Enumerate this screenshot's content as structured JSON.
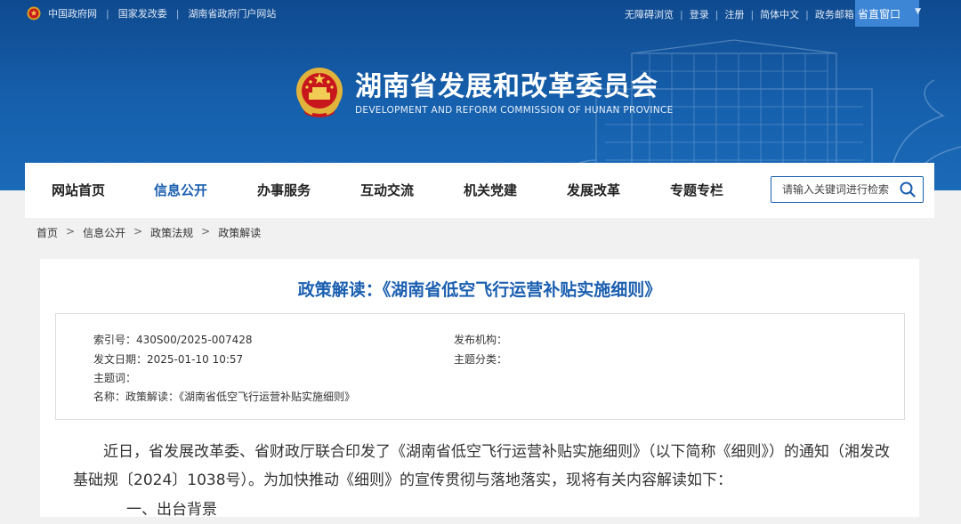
{
  "topbar": {
    "links": [
      "中国政府网",
      "国家发改委",
      "湖南省政府门户网站"
    ],
    "right_links": [
      "无障碍浏览",
      "登录",
      "注册",
      "简体中文",
      "政务邮箱"
    ],
    "province_window": "省直窗口"
  },
  "brand": {
    "name_cn": "湖南省发展和改革委员会",
    "name_en": "DEVELOPMENT AND REFORM COMMISSION OF HUNAN PROVINCE"
  },
  "nav": {
    "items": [
      "网站首页",
      "信息公开",
      "办事服务",
      "互动交流",
      "机关党建",
      "发展改革",
      "专题专栏"
    ],
    "active_index": 1,
    "search_placeholder": "请输入关键词进行检索"
  },
  "breadcrumb": [
    "首页",
    "信息公开",
    "政策法规",
    "政策解读"
  ],
  "article": {
    "title": "政策解读：《湖南省低空飞行运营补贴实施细则》",
    "meta": {
      "index_label": "索引号：",
      "index_value": "430S00/2025-007428",
      "publisher_label": "发布机构：",
      "publisher_value": "",
      "date_label": "发文日期：",
      "date_value": "2025-01-10 10:57",
      "category_label": "主题分类：",
      "category_value": "",
      "keywords_label": "主题词：",
      "keywords_value": "",
      "name_label": "名称：",
      "name_value": "政策解读：《湖南省低空飞行运营补贴实施细则》"
    },
    "body_p1": "近日，省发展改革委、省财政厅联合印发了《湖南省低空飞行运营补贴实施细则》（以下简称《细则》）的通知（湘发改基础规〔2024〕1038号）。为加快推动《细则》的宣传贯彻与落地落实，现将有关内容解读如下：",
    "body_p2": "一、出台背景"
  },
  "colors": {
    "header_blue": "#1660ad",
    "accent_blue": "#1b5fb0",
    "province_btn": "#3d86d6"
  }
}
